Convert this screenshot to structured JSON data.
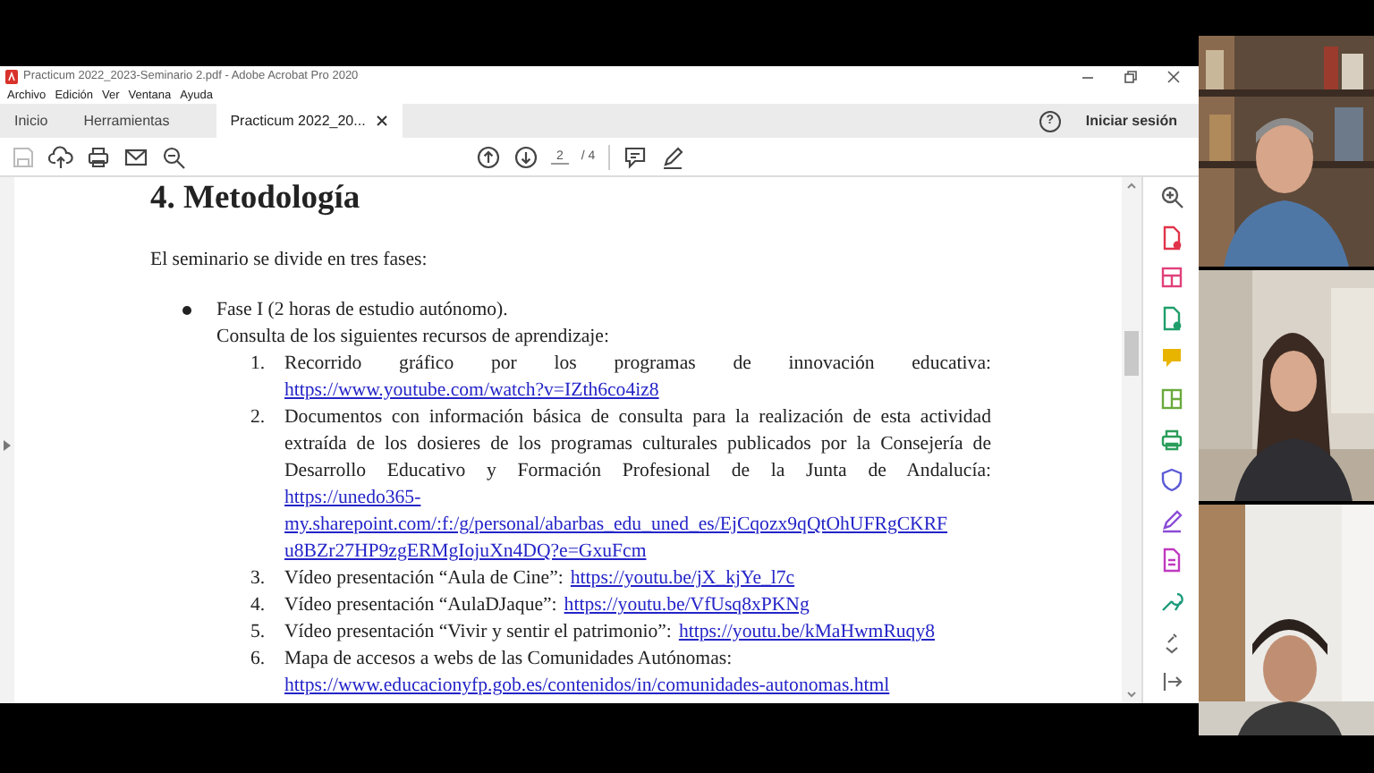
{
  "window": {
    "title": "Practicum 2022_2023-Seminario 2.pdf - Adobe Acrobat Pro 2020"
  },
  "menu": [
    "Archivo",
    "Edición",
    "Ver",
    "Ventana",
    "Ayuda"
  ],
  "tabs": [
    {
      "label": "Inicio",
      "selected": false
    },
    {
      "label": "Herramientas",
      "selected": false
    },
    {
      "label": "Practicum 2022_20...",
      "selected": true
    }
  ],
  "help": "?",
  "signin": "Iniciar sesión",
  "page": {
    "current": "2",
    "total": "/ 4"
  },
  "document": {
    "heading": "4. Metodología",
    "intro": "El seminario se divide en tres fases:",
    "bullets": [
      {
        "text": "Fase I (2 horas de estudio autónomo).",
        "subtext": "Consulta de los siguientes recursos de aprendizaje:",
        "items": [
          {
            "number": "1.",
            "kind": "spread",
            "text": "Recorrido gráfico por los programas de innovación educativa:",
            "links": [
              "https://www.youtube.com/watch?v=IZth6co4iz8"
            ]
          },
          {
            "number": "2.",
            "kind": "spread",
            "text": "Documentos con información básica de consulta para la realización de esta actividad extraída de los dosieres de los programas culturales publicados por la Consejería de Desarrollo Educativo y Formación Profesional de la Junta de Andalucía:",
            "links": [
              "https://unedo365-",
              "my.sharepoint.com/:f:/g/personal/abarbas_edu_uned_es/EjCqozx9qQtOhUFRgCKRF",
              "u8BZr27HP9zgERMgIojuXn4DQ?e=GxuFcm"
            ]
          },
          {
            "number": "3.",
            "kind": "inline",
            "text": "Vídeo presentación “Aula de Cine”:",
            "links": [
              "https://youtu.be/jX_kjYe_l7c"
            ]
          },
          {
            "number": "4.",
            "kind": "inline",
            "text": "Vídeo presentación “AulaDJaque”:",
            "links": [
              "https://youtu.be/VfUsq8xPKNg"
            ]
          },
          {
            "number": "5.",
            "kind": "inline",
            "text": "Vídeo presentación “Vivir y sentir el patrimonio”:",
            "links": [
              "https://youtu.be/kMaHwmRuqy8"
            ]
          },
          {
            "number": "6.",
            "kind": "plain",
            "text": "Mapa de accesos a webs de las Comunidades Autónomas:",
            "links": [
              "https://www.educacionyfp.gob.es/contenidos/in/comunidades-autonomas.html"
            ]
          }
        ]
      }
    ]
  },
  "video_tiles": [
    {
      "kind": "picture"
    },
    {
      "kind": "picture"
    },
    {
      "kind": "picture"
    }
  ]
}
